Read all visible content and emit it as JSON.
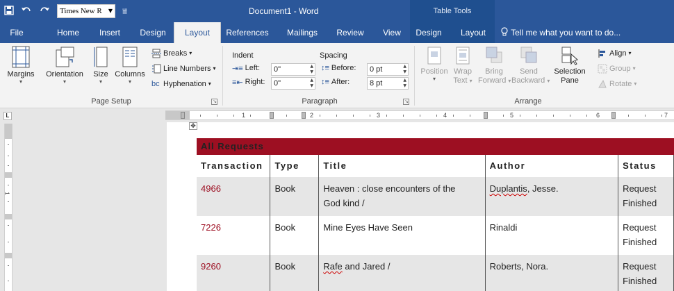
{
  "titlebar": {
    "font_box": "Times New R",
    "document_title": "Document1 - Word",
    "context_group": "Table Tools",
    "qat_icons": [
      "save-icon",
      "undo-icon",
      "redo-icon",
      "customize-icon"
    ]
  },
  "tabs": [
    {
      "label": "File"
    },
    {
      "label": "Home"
    },
    {
      "label": "Insert"
    },
    {
      "label": "Design"
    },
    {
      "label": "Layout"
    },
    {
      "label": "References"
    },
    {
      "label": "Mailings"
    },
    {
      "label": "Review"
    },
    {
      "label": "View"
    },
    {
      "label": "Design"
    },
    {
      "label": "Layout"
    }
  ],
  "tellme": "Tell me what you want to do...",
  "page_setup": {
    "margins": "Margins",
    "orientation": "Orientation",
    "size": "Size",
    "columns": "Columns",
    "breaks": "Breaks",
    "line_numbers": "Line Numbers",
    "hyphenation": "Hyphenation",
    "group_label": "Page Setup"
  },
  "paragraph": {
    "indent_label": "Indent",
    "spacing_label": "Spacing",
    "left_label": "Left:",
    "left_value": "0\"",
    "right_label": "Right:",
    "right_value": "0\"",
    "before_label": "Before:",
    "before_value": "0 pt",
    "after_label": "After:",
    "after_value": "8 pt",
    "group_label": "Paragraph"
  },
  "arrange": {
    "position": "Position",
    "wrap_1": "Wrap",
    "wrap_2": "Text",
    "bring_1": "Bring",
    "bring_2": "Forward",
    "send_1": "Send",
    "send_2": "Backward",
    "selection_1": "Selection",
    "selection_2": "Pane",
    "align": "Align",
    "group": "Group",
    "rotate": "Rotate",
    "group_label": "Arrange"
  },
  "ruler": {
    "tab_selector": "L",
    "h_numbers": [
      "1",
      "2",
      "3",
      "4",
      "5",
      "6",
      "7"
    ],
    "v_numbers": [
      "1"
    ]
  },
  "table": {
    "header": "All Requests",
    "columns": [
      "Transaction",
      "Type",
      "Title",
      "Author",
      "Status"
    ],
    "rows": [
      {
        "transaction": "4966",
        "type": "Book",
        "title_1": "Heaven : close encounters of the",
        "title_2": "God kind /",
        "author_a": "Duplantis",
        "author_b": ", Jesse.",
        "status_1": "Request",
        "status_2": "Finished"
      },
      {
        "transaction": "7226",
        "type": "Book",
        "title_1": "Mine Eyes Have Seen",
        "title_2": "",
        "author_a": "Rinaldi",
        "author_b": "",
        "status_1": "Request",
        "status_2": "Finished"
      },
      {
        "transaction": "9260",
        "type": "Book",
        "title_1": "Rafe",
        "title_2": " and Jared /",
        "author_a": "Roberts, Nora.",
        "author_b": "",
        "status_1": "Request",
        "status_2": "Finished"
      }
    ]
  }
}
